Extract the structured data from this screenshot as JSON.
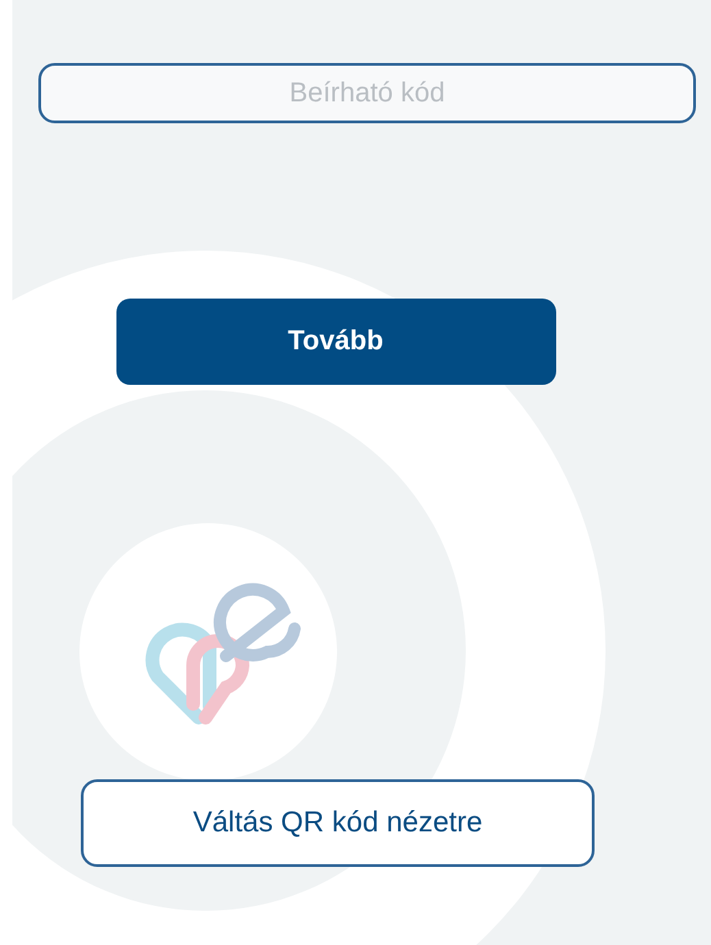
{
  "code_field": {
    "placeholder": "Beírható kód"
  },
  "next_button": {
    "label": "Tovább"
  },
  "switch_button": {
    "label": "Váltás QR kód nézetre"
  }
}
